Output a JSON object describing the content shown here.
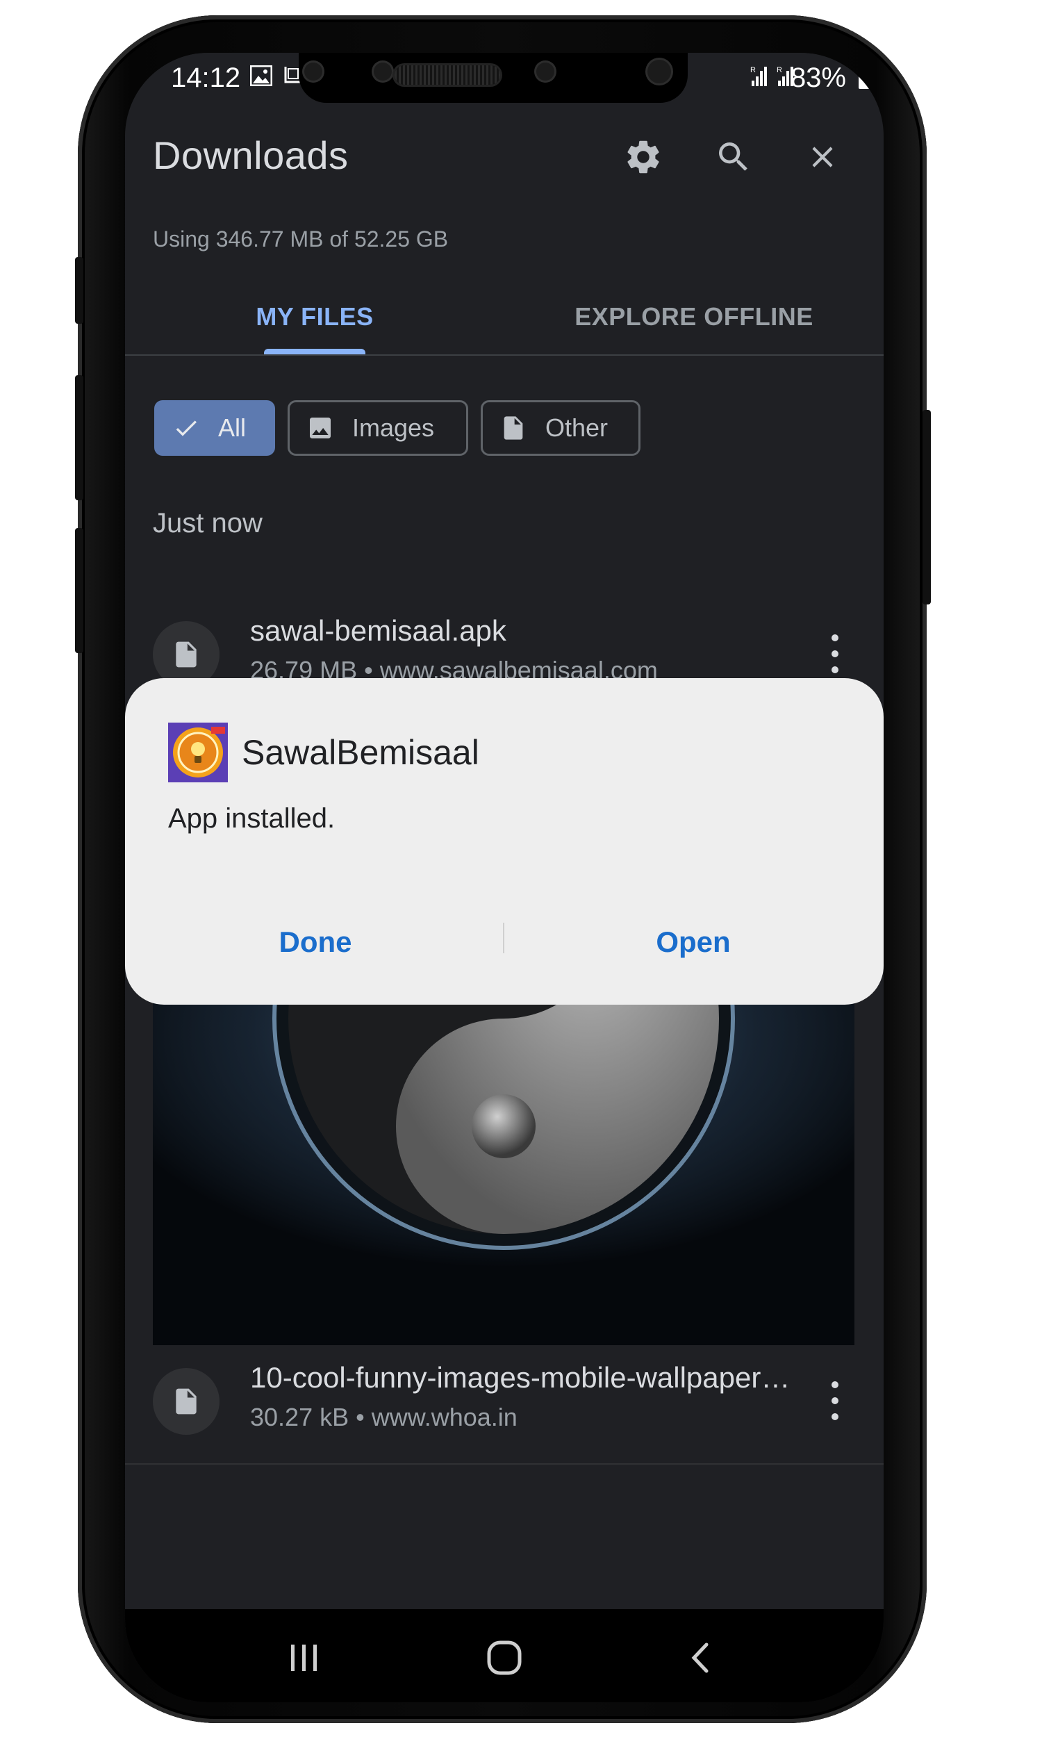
{
  "status_bar": {
    "time": "14:12",
    "battery": "83%"
  },
  "app_bar": {
    "title": "Downloads",
    "icons": [
      "gear-icon",
      "search-icon",
      "close-icon"
    ]
  },
  "storage": {
    "usage_text": "Using 346.77 MB of 52.25 GB"
  },
  "tabs": [
    {
      "label": "MY FILES",
      "selected": true
    },
    {
      "label": "EXPLORE OFFLINE",
      "selected": false
    }
  ],
  "filters": [
    {
      "label": "All",
      "icon": "check-icon",
      "selected": true
    },
    {
      "label": "Images",
      "icon": "image-icon",
      "selected": false
    },
    {
      "label": "Other",
      "icon": "file-icon",
      "selected": false
    }
  ],
  "section": {
    "label": "Just now"
  },
  "files": [
    {
      "name": "sawal-bemisaal.apk",
      "meta": "26.79 MB • www.sawalbemisaal.com",
      "icon": "file-icon"
    },
    {
      "name": "10-cool-funny-images-mobile-wallpaper…",
      "meta": "30.27 kB • www.whoa.in",
      "icon": "file-icon"
    }
  ],
  "dialog": {
    "app_name": "SawalBemisaal",
    "message": "App installed.",
    "done_label": "Done",
    "open_label": "Open"
  },
  "colors": {
    "accent": "#8ab4f8",
    "dialog_button": "#1a6dcc",
    "background": "#1f2024"
  }
}
